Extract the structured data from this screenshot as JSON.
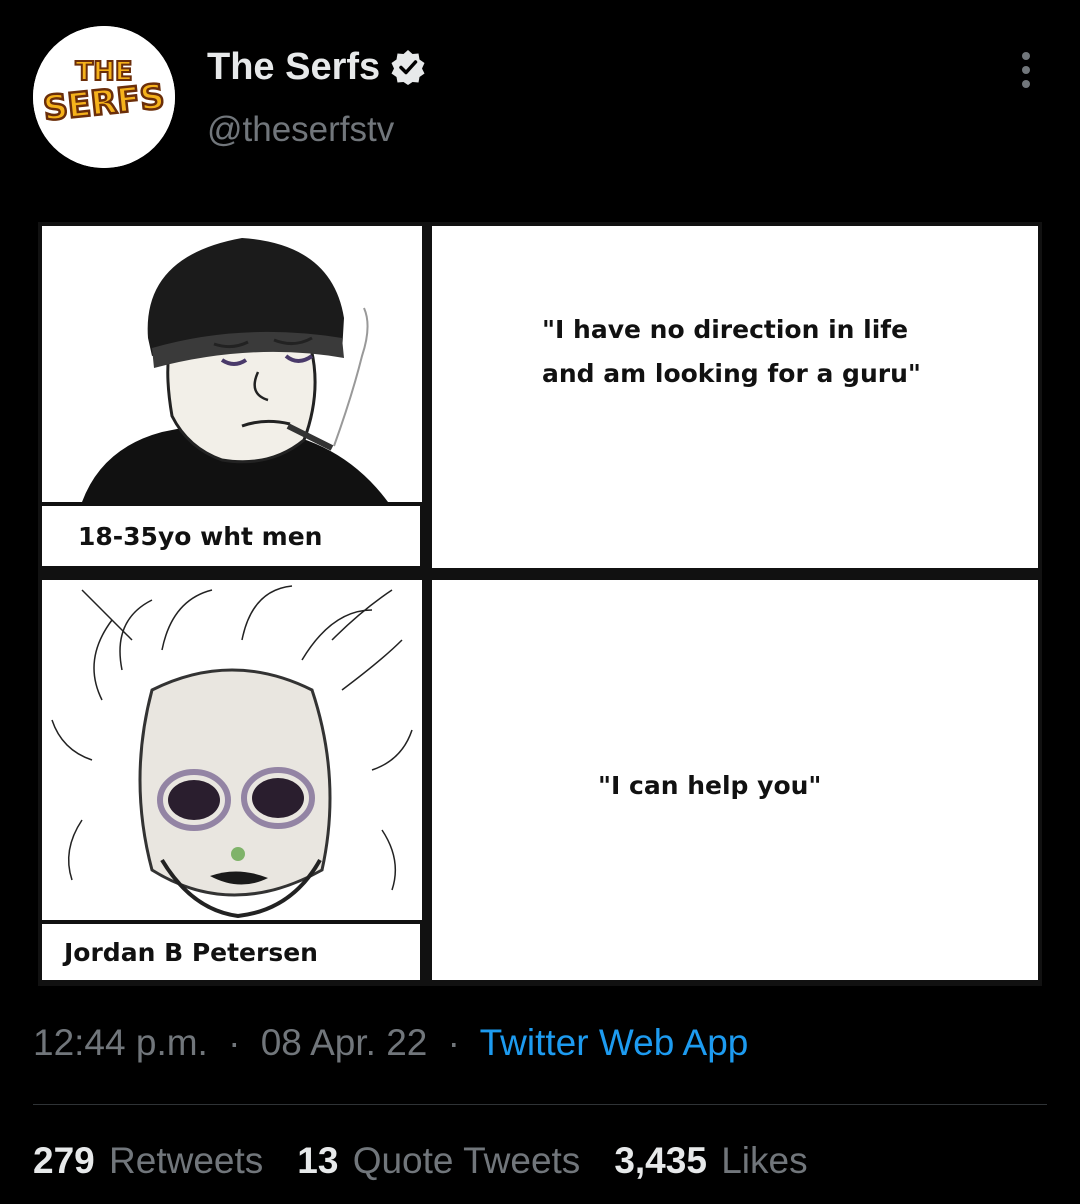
{
  "tweet": {
    "author": {
      "display_name": "The Serfs",
      "handle": "@theserfstv",
      "avatar_text_top": "THE",
      "avatar_text_bottom": "SERFS",
      "verified": true
    },
    "meme": {
      "panel_tl_caption": "18-35yo wht men",
      "panel_tr_quote": "\"I have no direction in life and am looking for a guru\"",
      "panel_bl_caption": "Jordan B Petersen",
      "panel_br_quote": "\"I can help you\""
    },
    "meta": {
      "time": "12:44 p.m.",
      "separator": "·",
      "date": "08 Apr. 22",
      "source": "Twitter Web App"
    },
    "stats": [
      {
        "number": "279",
        "label": "Retweets"
      },
      {
        "number": "13",
        "label": "Quote Tweets"
      },
      {
        "number": "3,435",
        "label": "Likes"
      }
    ]
  },
  "colors": {
    "background": "#000000",
    "primary_text": "#e7e9ea",
    "secondary_text": "#71767b",
    "link": "#1d9bf0",
    "divider": "#2f3336",
    "logo_yellow": "#f5b21b"
  },
  "icons": {
    "verified": "verified-badge-icon",
    "more": "more-dots-icon"
  }
}
